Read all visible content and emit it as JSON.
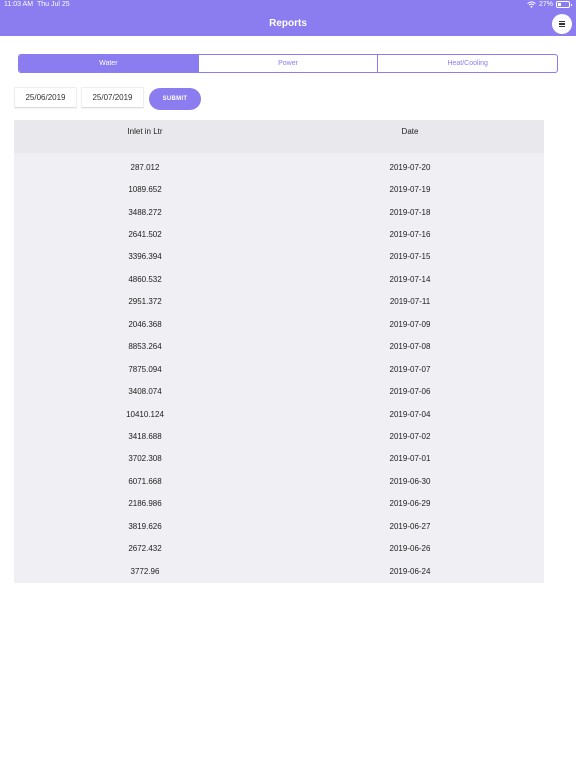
{
  "status_bar": {
    "time": "11:03 AM",
    "date": "Thu Jul 25",
    "battery": "27%",
    "battery_level": 0.27
  },
  "header": {
    "title": "Reports",
    "menu_icon": "hamburger-menu-icon"
  },
  "tabs": [
    {
      "label": "Water",
      "active": true
    },
    {
      "label": "Power",
      "active": false
    },
    {
      "label": "Heat/Cooling",
      "active": false
    }
  ],
  "filters": {
    "start_date": "25/06/2019",
    "end_date": "25/07/2019",
    "submit_label": "SUBMIT"
  },
  "table": {
    "columns": [
      "Inlet in Ltr",
      "Date"
    ],
    "rows": [
      [
        "287.012",
        "2019-07-20"
      ],
      [
        "1089.652",
        "2019-07-19"
      ],
      [
        "3488.272",
        "2019-07-18"
      ],
      [
        "2641.502",
        "2019-07-16"
      ],
      [
        "3396.394",
        "2019-07-15"
      ],
      [
        "4860.532",
        "2019-07-14"
      ],
      [
        "2951.372",
        "2019-07-11"
      ],
      [
        "2046.368",
        "2019-07-09"
      ],
      [
        "8853.264",
        "2019-07-08"
      ],
      [
        "7875.094",
        "2019-07-07"
      ],
      [
        "3408.074",
        "2019-07-06"
      ],
      [
        "10410.124",
        "2019-07-04"
      ],
      [
        "3418.688",
        "2019-07-02"
      ],
      [
        "3702.308",
        "2019-07-01"
      ],
      [
        "6071.668",
        "2019-06-30"
      ],
      [
        "2186.986",
        "2019-06-29"
      ],
      [
        "3819.626",
        "2019-06-27"
      ],
      [
        "2672.432",
        "2019-06-26"
      ],
      [
        "3772.96",
        "2019-06-24"
      ]
    ]
  },
  "colors": {
    "accent": "#8b7cf0",
    "table_background": "#efeff4"
  }
}
